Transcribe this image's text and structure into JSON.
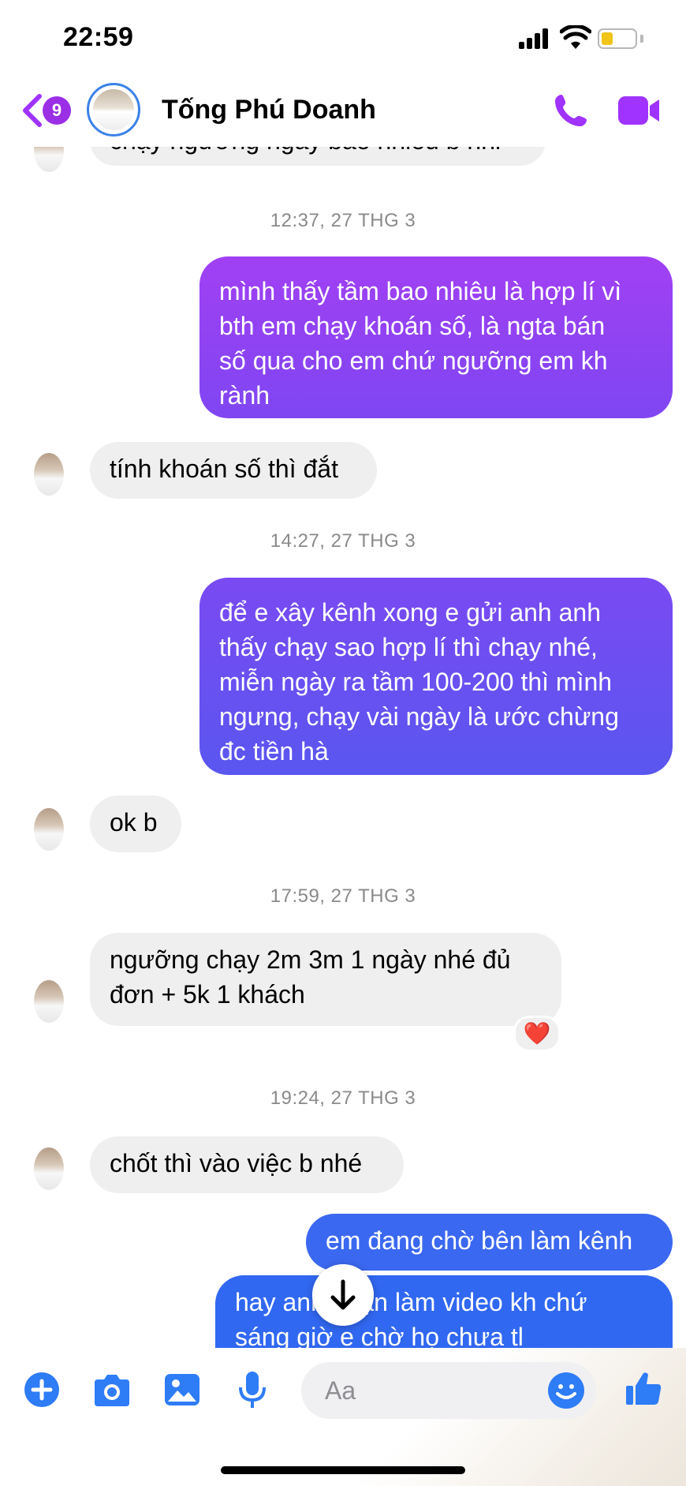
{
  "status_bar": {
    "time": "22:59"
  },
  "header": {
    "back_badge": "9",
    "contact_name": "Tống Phú Doanh",
    "icons": [
      "chevron-left-icon",
      "phone-icon",
      "video-camera-icon"
    ],
    "accent_color": "#a033ff"
  },
  "messages": [
    {
      "side": "in",
      "text": "chạy ngưỡng ngày bao nhiêu b nhỉ"
    },
    {
      "timestamp": "12:37, 27 THG 3"
    },
    {
      "side": "out",
      "lines": [
        "mình thấy tầm bao nhiêu là hợp lí vì",
        "bth em chạy khoán số, là ngta bán",
        "số qua cho em chứ ngưỡng em kh",
        "rành"
      ]
    },
    {
      "side": "in",
      "text": "tính khoán số thì đắt"
    },
    {
      "timestamp": "14:27, 27 THG 3"
    },
    {
      "side": "out",
      "lines": [
        "để e xây kênh xong e gửi anh anh",
        "thấy chạy sao hợp lí thì chạy nhé,",
        "miễn ngày ra tầm 100-200 thì mình",
        "ngưng, chạy vài ngày là ước chừng",
        "đc tiền hà"
      ]
    },
    {
      "side": "in",
      "text": "ok b"
    },
    {
      "timestamp": "17:59, 27 THG 3"
    },
    {
      "side": "in",
      "lines": [
        "ngưỡng chạy 2m 3m 1 ngày nhé đủ",
        "đơn + 5k 1 khách"
      ],
      "reaction": "❤️"
    },
    {
      "timestamp": "19:24, 27 THG 3"
    },
    {
      "side": "in",
      "text": "chốt thì vào việc b nhé"
    },
    {
      "side": "out",
      "text": "em đang chờ bên làm kênh"
    },
    {
      "side": "out",
      "lines": [
        "hay anh nhận làm video kh chứ",
        "sáng giờ e chờ họ chưa tl"
      ]
    }
  ],
  "composer": {
    "placeholder": "Aa",
    "icons": [
      "plus-icon",
      "camera-icon",
      "image-icon",
      "microphone-icon",
      "emoji-icon",
      "thumbs-up-icon"
    ],
    "icon_color": "#2e7cf6"
  },
  "scroll_down_icon": "arrow-down-icon"
}
